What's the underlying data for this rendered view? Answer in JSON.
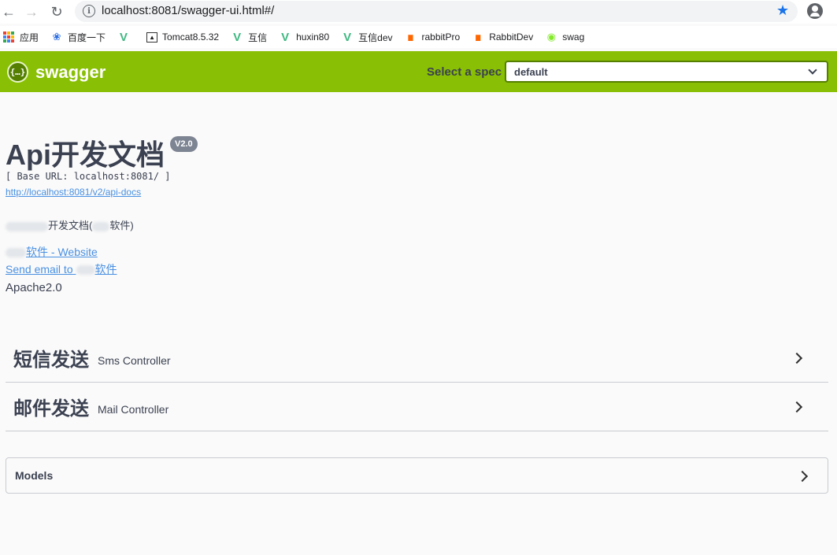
{
  "browser": {
    "url": "localhost:8081/swagger-ui.html#/",
    "bookmarks": [
      {
        "label": "应用",
        "icon": "apps-grid-icon"
      },
      {
        "label": "百度一下",
        "icon": "baidu-paw-icon"
      },
      {
        "label": "",
        "icon": "vue-icon"
      },
      {
        "label": "Tomcat8.5.32",
        "icon": "tomcat-icon"
      },
      {
        "label": "互信",
        "icon": "vue-icon"
      },
      {
        "label": "huxin80",
        "icon": "vue-icon"
      },
      {
        "label": "互信dev",
        "icon": "vue-icon"
      },
      {
        "label": "rabbitPro",
        "icon": "rabbitmq-icon"
      },
      {
        "label": "RabbitDev",
        "icon": "rabbitmq-icon"
      },
      {
        "label": "swag",
        "icon": "swagger-icon"
      }
    ]
  },
  "topbar": {
    "logo_badge": "{…}",
    "logo_text": "swagger",
    "spec_label": "Select a spec",
    "spec_value": "default",
    "color": "#89bf04"
  },
  "info": {
    "title": "Api开发文档",
    "version": "V2.0",
    "base_url": "[ Base URL: localhost:8081/ ]",
    "docs_link": "http://localhost:8081/v2/api-docs",
    "description_a": "开发文档(",
    "description_b": "软件)",
    "website_link": "软件 - Website",
    "email_link_a": "Send email to ",
    "email_link_b": "软件",
    "license": "Apache2.0"
  },
  "tags": [
    {
      "name": "短信发送",
      "description": "Sms Controller"
    },
    {
      "name": "邮件发送",
      "description": "Mail Controller"
    }
  ],
  "models": {
    "title": "Models"
  }
}
